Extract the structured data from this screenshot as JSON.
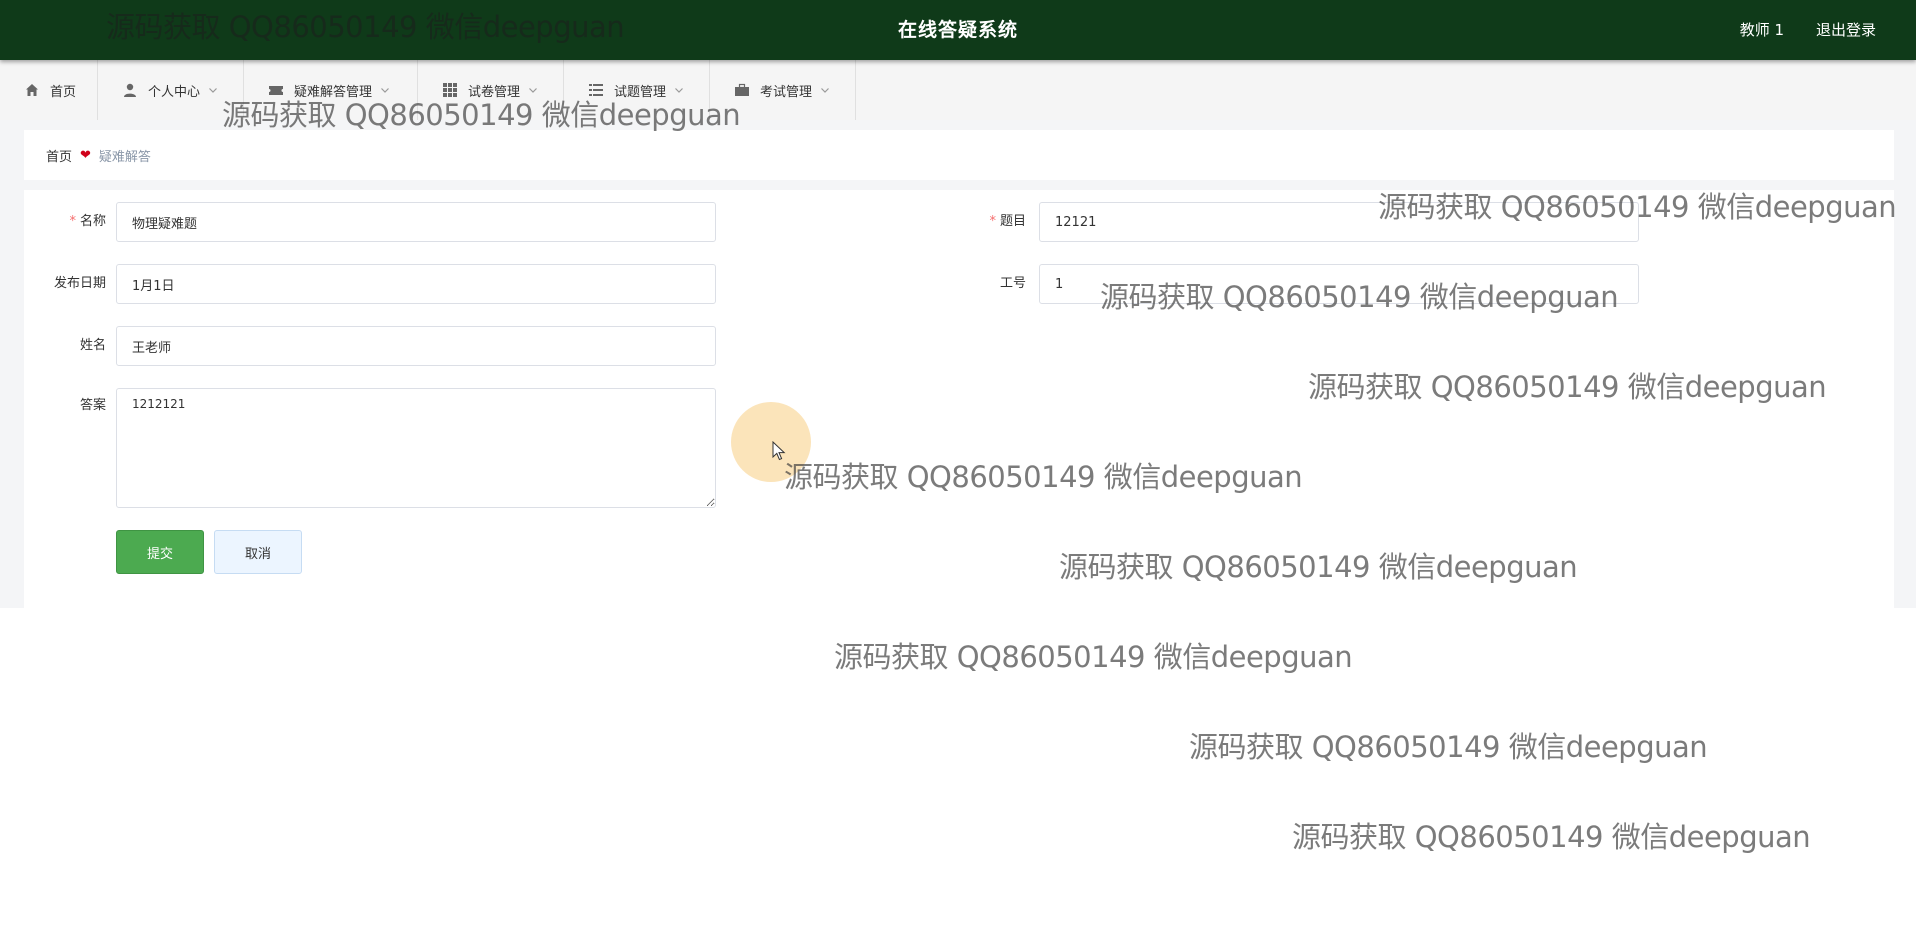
{
  "header": {
    "title": "在线答疑系统",
    "user": "教师 1",
    "logout": "退出登录",
    "bg_color": "#0f3a19"
  },
  "nav": {
    "items": [
      {
        "label": "首页",
        "icon": "home-icon"
      },
      {
        "label": "个人中心",
        "icon": "user-icon"
      },
      {
        "label": "疑难解答管理",
        "icon": "ticket-icon"
      },
      {
        "label": "试卷管理",
        "icon": "grid-icon"
      },
      {
        "label": "试题管理",
        "icon": "list-icon"
      },
      {
        "label": "考试管理",
        "icon": "briefcase-icon"
      }
    ]
  },
  "breadcrumb": {
    "home": "首页",
    "separator": "❤",
    "current": "疑难解答"
  },
  "form": {
    "name_label": "名称",
    "name_value": "物理疑难题",
    "question_label": "题目",
    "question_value": "12121",
    "date_label": "发布日期",
    "date_value": "1月1日",
    "jobno_label": "工号",
    "jobno_value": "1",
    "teacher_label": "姓名",
    "teacher_value": "王老师",
    "answer_label": "答案",
    "answer_value": "1212121",
    "submit_label": "提交",
    "cancel_label": "取消",
    "submit_color": "#4caa50"
  },
  "watermark": {
    "text": "源码获取 QQ86050149 微信deepguan"
  }
}
